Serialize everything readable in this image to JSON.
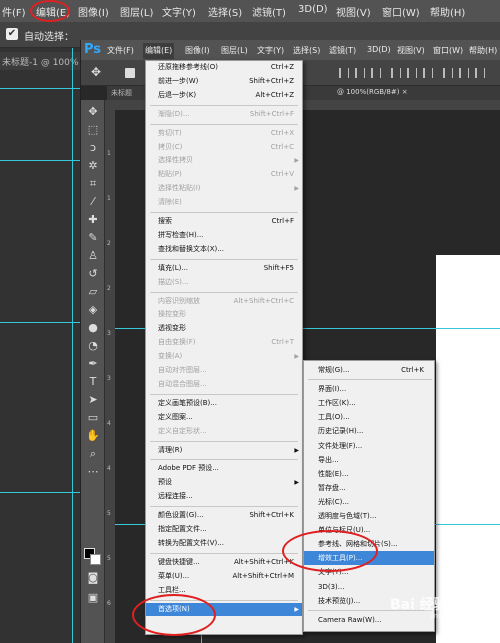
{
  "background_window": {
    "menu": [
      "件(F)",
      "编辑(E)",
      "图像(I)",
      "图层(L)",
      "文字(Y)",
      "选择(S)",
      "滤镜(T)",
      "3D(D)",
      "视图(V)",
      "窗口(W)",
      "帮助(H)"
    ],
    "auto_select_label": "自动选择：",
    "doc_tab": "未标题-1 @ 100% (",
    "guide_color": "#35c8d8"
  },
  "ps_window": {
    "logo": "Ps",
    "menu": [
      "文件(F)",
      "编辑(E)",
      "图像(I)",
      "图层(L)",
      "文字(Y)",
      "选择(S)",
      "滤镜(T)",
      "3D(D)",
      "视图(V)",
      "窗口(W)",
      "帮助(H)"
    ],
    "doc_tab_left": "未标题",
    "doc_tab_right": "@ 100%(RGB/8#) ×",
    "ruler_numbers": [
      "1",
      "1",
      "2",
      "2",
      "3",
      "3",
      "4",
      "4",
      "5",
      "5",
      "6"
    ]
  },
  "edit_menu": [
    {
      "label": "还原拖移参考线(O)",
      "shortcut": "Ctrl+Z",
      "disabled": false
    },
    {
      "label": "前进一步(W)",
      "shortcut": "Shift+Ctrl+Z",
      "disabled": false
    },
    {
      "label": "后退一步(K)",
      "shortcut": "Alt+Ctrl+Z",
      "disabled": false
    },
    {
      "sep": true
    },
    {
      "label": "渐隐(D)...",
      "shortcut": "Shift+Ctrl+F",
      "disabled": true
    },
    {
      "sep": true
    },
    {
      "label": "剪切(T)",
      "shortcut": "Ctrl+X",
      "disabled": true
    },
    {
      "label": "拷贝(C)",
      "shortcut": "Ctrl+C",
      "disabled": true
    },
    {
      "label": "选择性拷贝",
      "shortcut": "",
      "disabled": true,
      "arrow": true
    },
    {
      "label": "粘贴(P)",
      "shortcut": "Ctrl+V",
      "disabled": true
    },
    {
      "label": "选择性粘贴(I)",
      "shortcut": "",
      "disabled": true,
      "arrow": true
    },
    {
      "label": "清除(E)",
      "shortcut": "",
      "disabled": true
    },
    {
      "sep": true
    },
    {
      "label": "搜索",
      "shortcut": "Ctrl+F",
      "disabled": false
    },
    {
      "label": "拼写检查(H)...",
      "shortcut": "",
      "disabled": false
    },
    {
      "label": "查找和替换文本(X)...",
      "shortcut": "",
      "disabled": false
    },
    {
      "sep": true
    },
    {
      "label": "填充(L)...",
      "shortcut": "Shift+F5",
      "disabled": false
    },
    {
      "label": "描边(S)...",
      "shortcut": "",
      "disabled": true
    },
    {
      "sep": true
    },
    {
      "label": "内容识别缩放",
      "shortcut": "Alt+Shift+Ctrl+C",
      "disabled": true
    },
    {
      "label": "操控变形",
      "shortcut": "",
      "disabled": true
    },
    {
      "label": "透视变形",
      "shortcut": "",
      "disabled": false
    },
    {
      "label": "自由变换(F)",
      "shortcut": "Ctrl+T",
      "disabled": true
    },
    {
      "label": "变换(A)",
      "shortcut": "",
      "disabled": true,
      "arrow": true
    },
    {
      "label": "自动对齐图层...",
      "shortcut": "",
      "disabled": true
    },
    {
      "label": "自动混合图层...",
      "shortcut": "",
      "disabled": true
    },
    {
      "sep": true
    },
    {
      "label": "定义画笔预设(B)...",
      "shortcut": "",
      "disabled": false
    },
    {
      "label": "定义图案...",
      "shortcut": "",
      "disabled": false
    },
    {
      "label": "定义自定形状...",
      "shortcut": "",
      "disabled": true
    },
    {
      "sep": true
    },
    {
      "label": "清理(R)",
      "shortcut": "",
      "disabled": false,
      "arrow": true
    },
    {
      "sep": true
    },
    {
      "label": "Adobe PDF 预设...",
      "shortcut": "",
      "disabled": false
    },
    {
      "label": "预设",
      "shortcut": "",
      "disabled": false,
      "arrow": true
    },
    {
      "label": "远程连接...",
      "shortcut": "",
      "disabled": false
    },
    {
      "sep": true
    },
    {
      "label": "颜色设置(G)...",
      "shortcut": "Shift+Ctrl+K",
      "disabled": false
    },
    {
      "label": "指定配置文件...",
      "shortcut": "",
      "disabled": false
    },
    {
      "label": "转换为配置文件(V)...",
      "shortcut": "",
      "disabled": false
    },
    {
      "sep": true
    },
    {
      "label": "键盘快捷键...",
      "shortcut": "Alt+Shift+Ctrl+K",
      "disabled": false
    },
    {
      "label": "菜单(U)...",
      "shortcut": "Alt+Shift+Ctrl+M",
      "disabled": false
    },
    {
      "label": "工具栏...",
      "shortcut": "",
      "disabled": false
    },
    {
      "sep": true
    },
    {
      "label": "首选项(N)",
      "shortcut": "",
      "disabled": false,
      "arrow": true,
      "highlight": true
    }
  ],
  "preferences_submenu": [
    {
      "label": "常规(G)...",
      "shortcut": "Ctrl+K"
    },
    {
      "sep": true
    },
    {
      "label": "界面(I)..."
    },
    {
      "label": "工作区(K)..."
    },
    {
      "label": "工具(O)..."
    },
    {
      "label": "历史记录(H)..."
    },
    {
      "label": "文件处理(F)..."
    },
    {
      "label": "导出..."
    },
    {
      "label": "性能(E)..."
    },
    {
      "label": "暂存盘..."
    },
    {
      "label": "光标(C)..."
    },
    {
      "label": "透明度与色域(T)..."
    },
    {
      "label": "单位与标尺(U)..."
    },
    {
      "label": "参考线、网格和切片(S)..."
    },
    {
      "label": "增效工具(P)...",
      "highlight": true
    },
    {
      "label": "文字(Y)..."
    },
    {
      "label": "3D(3)..."
    },
    {
      "label": "技术预览(J)..."
    },
    {
      "sep": true
    },
    {
      "label": "Camera Raw(W)..."
    }
  ],
  "watermark": {
    "brand": "Bai 经验",
    "url": "jingyan.baidu.com"
  }
}
